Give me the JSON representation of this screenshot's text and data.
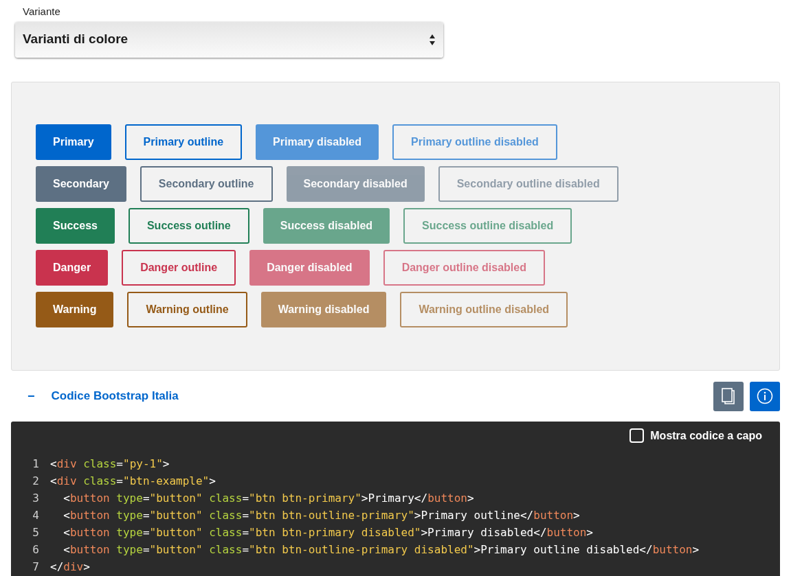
{
  "variant_select": {
    "label": "Variante",
    "value": "Varianti di colore"
  },
  "button_rows": [
    {
      "color": "#0066cc",
      "buttons": [
        {
          "label": "Primary",
          "kind": "solid",
          "disabled": false
        },
        {
          "label": "Primary outline",
          "kind": "outline",
          "disabled": false
        },
        {
          "label": "Primary disabled",
          "kind": "solid",
          "disabled": true
        },
        {
          "label": "Primary outline disabled",
          "kind": "outline",
          "disabled": true
        }
      ]
    },
    {
      "color": "#5d7083",
      "buttons": [
        {
          "label": "Secondary",
          "kind": "solid",
          "disabled": false
        },
        {
          "label": "Secondary outline",
          "kind": "outline",
          "disabled": false
        },
        {
          "label": "Secondary disabled",
          "kind": "solid",
          "disabled": true
        },
        {
          "label": "Secondary outline disabled",
          "kind": "outline",
          "disabled": true
        }
      ]
    },
    {
      "color": "#217f56",
      "buttons": [
        {
          "label": "Success",
          "kind": "solid",
          "disabled": false
        },
        {
          "label": "Success outline",
          "kind": "outline",
          "disabled": false
        },
        {
          "label": "Success disabled",
          "kind": "solid",
          "disabled": true
        },
        {
          "label": "Success outline disabled",
          "kind": "outline",
          "disabled": true
        }
      ]
    },
    {
      "color": "#c9334e",
      "buttons": [
        {
          "label": "Danger",
          "kind": "solid",
          "disabled": false
        },
        {
          "label": "Danger outline",
          "kind": "outline",
          "disabled": false
        },
        {
          "label": "Danger disabled",
          "kind": "solid",
          "disabled": true
        },
        {
          "label": "Danger outline disabled",
          "kind": "outline",
          "disabled": true
        }
      ]
    },
    {
      "color": "#955a17",
      "buttons": [
        {
          "label": "Warning",
          "kind": "solid",
          "disabled": false
        },
        {
          "label": "Warning outline",
          "kind": "outline",
          "disabled": false
        },
        {
          "label": "Warning disabled",
          "kind": "solid",
          "disabled": true
        },
        {
          "label": "Warning outline disabled",
          "kind": "outline",
          "disabled": true
        }
      ]
    }
  ],
  "code_section": {
    "toggle": "−",
    "title": "Codice Bootstrap Italia"
  },
  "code_block": {
    "wrap_option": {
      "label": "Mostra codice a capo",
      "checked": false
    },
    "lines": [
      {
        "number": "1",
        "text": "<div class=\"py-1\">"
      },
      {
        "number": "2",
        "text": "<div class=\"btn-example\">"
      },
      {
        "number": "3",
        "text": "  <button type=\"button\" class=\"btn btn-primary\">Primary</button>"
      },
      {
        "number": "4",
        "text": "  <button type=\"button\" class=\"btn btn-outline-primary\">Primary outline</button>"
      },
      {
        "number": "5",
        "text": "  <button type=\"button\" class=\"btn btn-primary disabled\">Primary disabled</button>"
      },
      {
        "number": "6",
        "text": "  <button type=\"button\" class=\"btn btn-outline-primary disabled\">Primary outline disabled</button>"
      },
      {
        "number": "7",
        "text": "</div>"
      }
    ]
  }
}
